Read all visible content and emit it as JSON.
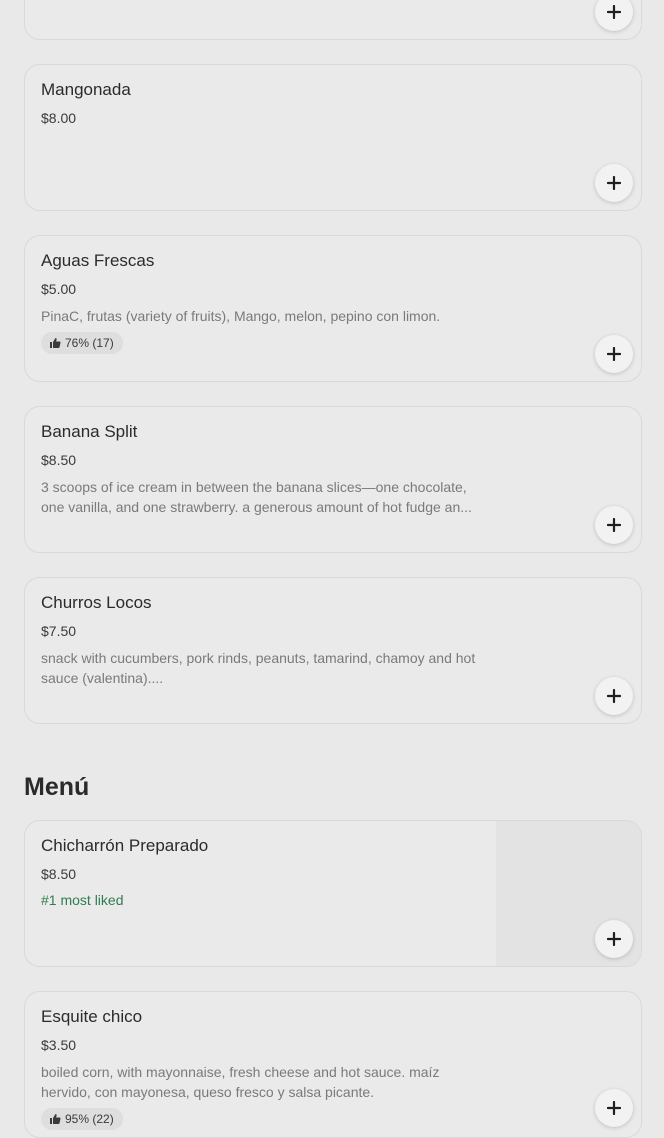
{
  "featured": {
    "items": [
      {
        "name": "Mangonada",
        "price": "$8.00"
      },
      {
        "name": "Aguas Frescas",
        "price": "$5.00",
        "description": "PinaC, frutas (variety of fruits), Mango, melon, pepino con limon.",
        "rating": "76% (17)"
      },
      {
        "name": "Banana Split",
        "price": "$8.50",
        "description": "3 scoops of ice cream in between the banana slices—one chocolate, one vanilla, and one strawberry. a generous amount of hot fudge an..."
      },
      {
        "name": "Churros Locos",
        "price": "$7.50",
        "description": "snack with cucumbers, pork rinds, peanuts, tamarind, chamoy and hot sauce (valentina)...."
      }
    ]
  },
  "menu": {
    "title": "Menú",
    "items": [
      {
        "name": "Chicharrón Preparado",
        "price": "$8.50",
        "badge": "#1 most liked"
      },
      {
        "name": "Esquite chico",
        "price": "$3.50",
        "description": "boiled corn, with mayonnaise, fresh cheese and hot sauce. maíz hervido, con mayonesa, queso fresco y salsa picante.",
        "rating": "95% (22)"
      }
    ]
  },
  "icons": {
    "add": "plus-icon",
    "thumb": "thumbs-up-icon"
  },
  "colors": {
    "background": "#e9e9e9",
    "accent_green": "#2e7d4f"
  }
}
